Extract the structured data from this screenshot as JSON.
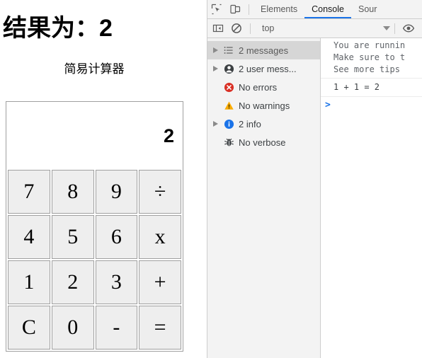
{
  "page": {
    "result_heading_label": "结果为：",
    "result_value": "2",
    "calc_title": "简易计算器",
    "display_value": "2",
    "buttons": [
      [
        "7",
        "8",
        "9",
        "÷"
      ],
      [
        "4",
        "5",
        "6",
        "x"
      ],
      [
        "1",
        "2",
        "3",
        "+"
      ],
      [
        "C",
        "0",
        "-",
        "="
      ]
    ]
  },
  "devtools": {
    "icons": {
      "inspect": "inspect-element-icon",
      "device": "device-toolbar-icon",
      "sidebar_toggle": "console-sidebar-toggle-icon",
      "clear": "clear-console-icon",
      "eye": "live-expression-eye-icon"
    },
    "tabs": [
      {
        "label": "Elements",
        "active": false
      },
      {
        "label": "Console",
        "active": true
      },
      {
        "label": "Sour",
        "active": false
      }
    ],
    "toolbar": {
      "context_value": "top"
    },
    "sidebar": [
      {
        "label": "2 messages",
        "icon": "list-icon",
        "arrow": true,
        "selected": true
      },
      {
        "label": "2 user mess...",
        "icon": "user-icon",
        "arrow": true,
        "selected": false
      },
      {
        "label": "No errors",
        "icon": "error-icon",
        "arrow": false,
        "selected": false
      },
      {
        "label": "No warnings",
        "icon": "warning-icon",
        "arrow": false,
        "selected": false
      },
      {
        "label": "2 info",
        "icon": "info-icon",
        "arrow": true,
        "selected": false
      },
      {
        "label": "No verbose",
        "icon": "bug-icon",
        "arrow": false,
        "selected": false
      }
    ],
    "console": {
      "tips_line1": "You are runnin",
      "tips_line2": "Make sure to t",
      "tips_line3": "See more tips",
      "evaluated_result": "1 + 1 = 2",
      "prompt_caret": ">"
    }
  },
  "colors": {
    "accent": "#1a73e8",
    "error": "#d93025",
    "warning": "#f9ab00",
    "info": "#1a73e8",
    "button_face": "#eeeeee",
    "border": "#a0a0a0"
  }
}
